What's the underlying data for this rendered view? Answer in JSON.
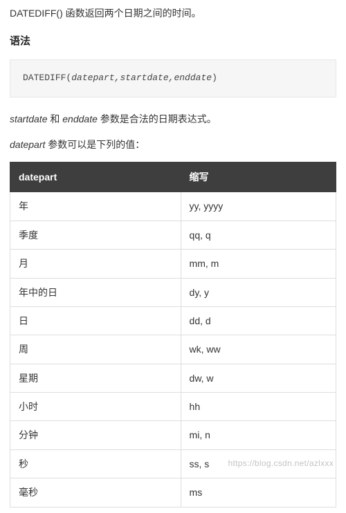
{
  "intro": "DATEDIFF() 函数返回两个日期之间的时间。",
  "syntax_heading": "语法",
  "syntax_code": {
    "fn": "DATEDIFF",
    "open": "(",
    "args": "datepart,startdate,enddate",
    "close": ")"
  },
  "note1_pre": "startdate",
  "note1_mid": " 和 ",
  "note1_em2": "enddate",
  "note1_post": " 参数是合法的日期表达式。",
  "note2_em": "datepart",
  "note2_post": " 参数可以是下列的值：",
  "table": {
    "headers": [
      "datepart",
      "缩写"
    ],
    "rows": [
      {
        "c0": "年",
        "c1": "yy, yyyy"
      },
      {
        "c0": "季度",
        "c1": "qq, q"
      },
      {
        "c0": "月",
        "c1": "mm, m"
      },
      {
        "c0": "年中的日",
        "c1": "dy, y"
      },
      {
        "c0": "日",
        "c1": "dd, d"
      },
      {
        "c0": "周",
        "c1": "wk, ww"
      },
      {
        "c0": "星期",
        "c1": "dw, w"
      },
      {
        "c0": "小时",
        "c1": "hh"
      },
      {
        "c0": "分钟",
        "c1": "mi, n"
      },
      {
        "c0": "秒",
        "c1": "ss, s"
      },
      {
        "c0": "毫秒",
        "c1": "ms"
      }
    ]
  },
  "watermark": "https://blog.csdn.net/azlxxx"
}
